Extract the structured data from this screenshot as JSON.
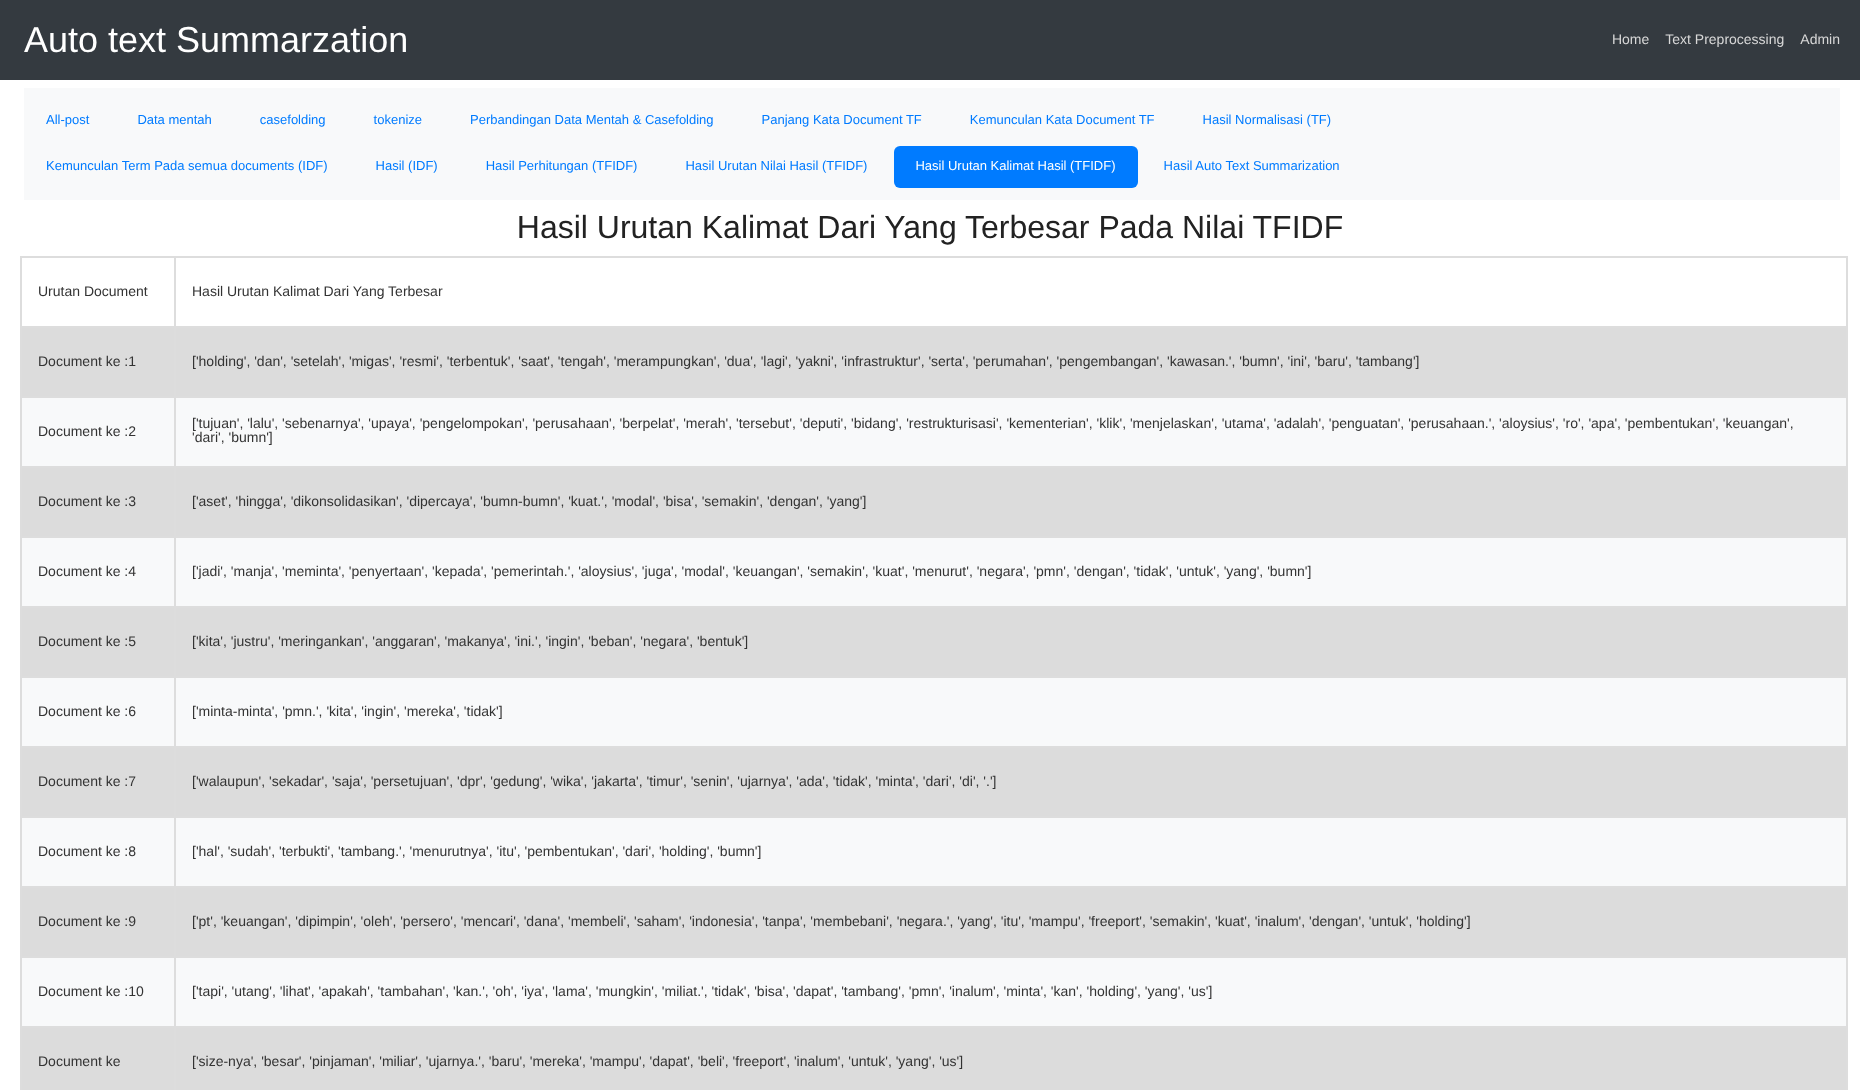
{
  "navbar": {
    "title": "Auto text Summarzation",
    "links": [
      "Home",
      "Text Preprocessing",
      "Admin"
    ]
  },
  "tab_rows": [
    [
      {
        "label": "All-post",
        "selected": false
      },
      {
        "label": "Data mentah",
        "selected": false
      },
      {
        "label": "casefolding",
        "selected": false
      },
      {
        "label": "tokenize",
        "selected": false
      },
      {
        "label": "Perbandingan Data Mentah & Casefolding",
        "selected": false
      },
      {
        "label": "Panjang Kata Document TF",
        "selected": false
      },
      {
        "label": "Kemunculan Kata Document TF",
        "selected": false
      },
      {
        "label": "Hasil Normalisasi (TF)",
        "selected": false
      }
    ],
    [
      {
        "label": "Kemunculan Term Pada semua documents (IDF)",
        "selected": false
      },
      {
        "label": "Hasil (IDF)",
        "selected": false
      },
      {
        "label": "Hasil Perhitungan (TFIDF)",
        "selected": false
      },
      {
        "label": "Hasil Urutan Nilai Hasil (TFIDF)",
        "selected": false
      },
      {
        "label": "Hasil Urutan Kalimat Hasil (TFIDF)",
        "selected": true
      },
      {
        "label": "Hasil Auto Text Summarization",
        "selected": false
      }
    ]
  ],
  "heading": "Hasil Urutan Kalimat Dari Yang Terbesar Pada Nilai TFIDF",
  "table": {
    "columns": [
      "Urutan Document",
      "Hasil Urutan Kalimat Dari Yang Terbesar"
    ],
    "rows": [
      [
        "Document ke :1",
        "['holding', 'dan', 'setelah', 'migas', 'resmi', 'terbentuk', 'saat', 'tengah', 'merampungkan', 'dua', 'lagi', 'yakni', 'infrastruktur', 'serta', 'perumahan', 'pengembangan', 'kawasan.', 'bumn', 'ini', 'baru', 'tambang']"
      ],
      [
        "Document ke :2",
        "['tujuan', 'lalu', 'sebenarnya', 'upaya', 'pengelompokan', 'perusahaan', 'berpelat', 'merah', 'tersebut', 'deputi', 'bidang', 'restrukturisasi', 'kementerian', 'klik', 'menjelaskan', 'utama', 'adalah', 'penguatan', 'perusahaan.', 'aloysius', 'ro', 'apa', 'pembentukan', 'keuangan', 'dari', 'bumn']"
      ],
      [
        "Document ke :3",
        "['aset', 'hingga', 'dikonsolidasikan', 'dipercaya', 'bumn-bumn', 'kuat.', 'modal', 'bisa', 'semakin', 'dengan', 'yang']"
      ],
      [
        "Document ke :4",
        "['jadi', 'manja', 'meminta', 'penyertaan', 'kepada', 'pemerintah.', 'aloysius', 'juga', 'modal', 'keuangan', 'semakin', 'kuat', 'menurut', 'negara', 'pmn', 'dengan', 'tidak', 'untuk', 'yang', 'bumn']"
      ],
      [
        "Document ke :5",
        "['kita', 'justru', 'meringankan', 'anggaran', 'makanya', 'ini.', 'ingin', 'beban', 'negara', 'bentuk']"
      ],
      [
        "Document ke :6",
        "['minta-minta', 'pmn.', 'kita', 'ingin', 'mereka', 'tidak']"
      ],
      [
        "Document ke :7",
        "['walaupun', 'sekadar', 'saja', 'persetujuan', 'dpr', 'gedung', 'wika', 'jakarta', 'timur', 'senin', 'ujarnya', 'ada', 'tidak', 'minta', 'dari', 'di', '.']"
      ],
      [
        "Document ke :8",
        "['hal', 'sudah', 'terbukti', 'tambang.', 'menurutnya', 'itu', 'pembentukan', 'dari', 'holding', 'bumn']"
      ],
      [
        "Document ke :9",
        "['pt', 'keuangan', 'dipimpin', 'oleh', 'persero', 'mencari', 'dana', 'membeli', 'saham', 'indonesia', 'tanpa', 'membebani', 'negara.', 'yang', 'itu', 'mampu', 'freeport', 'semakin', 'kuat', 'inalum', 'dengan', 'untuk', 'holding']"
      ],
      [
        "Document ke :10",
        "['tapi', 'utang', 'lihat', 'apakah', 'tambahan', 'kan.', 'oh', 'iya', 'lama', 'mungkin', 'miliat.', 'tidak', 'bisa', 'dapat', 'tambang', 'pmn', 'inalum', 'minta', 'kan', 'holding', 'yang', 'us']"
      ],
      [
        "Document ke",
        "['size-nya', 'besar', 'pinjaman', 'miliar', 'ujarnya.', 'baru', 'mereka', 'mampu', 'dapat', 'beli', 'freeport', 'inalum', 'untuk', 'yang', 'us']"
      ]
    ]
  }
}
